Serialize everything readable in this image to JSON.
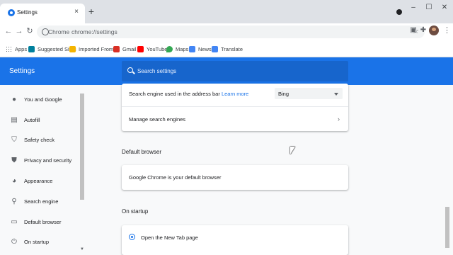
{
  "browser": {
    "tab_title": "Settings",
    "tab_close": "×",
    "new_tab": "+",
    "window_controls": {
      "minimize": "–",
      "maximize": "☐",
      "close": "✕"
    }
  },
  "toolbar": {
    "back": "←",
    "forward": "→",
    "reload": "↻",
    "site_label": "Chrome",
    "url": "chrome://settings",
    "star": "☆",
    "menu": "⋮"
  },
  "bookmarks": [
    {
      "label": "Apps",
      "icon": "apps-grid-icon",
      "color": "#5f6368"
    },
    {
      "label": "Suggested Sites",
      "icon": "bing-icon",
      "color": "#00809d"
    },
    {
      "label": "Imported From IE",
      "icon": "folder-icon",
      "color": "#f4b400"
    },
    {
      "label": "Gmail",
      "icon": "gmail-icon",
      "color": "#d93025"
    },
    {
      "label": "YouTube",
      "icon": "youtube-icon",
      "color": "#ff0000"
    },
    {
      "label": "Maps",
      "icon": "maps-pin-icon",
      "color": "#34a853"
    },
    {
      "label": "News",
      "icon": "news-icon",
      "color": "#4285f4"
    },
    {
      "label": "Translate",
      "icon": "translate-icon",
      "color": "#4285f4"
    }
  ],
  "header": {
    "title": "Settings",
    "search_placeholder": "Search settings",
    "accent": "#1a73e8"
  },
  "sidebar": {
    "items": [
      {
        "label": "You and Google",
        "icon": "person-icon"
      },
      {
        "label": "Autofill",
        "icon": "clipboard-icon"
      },
      {
        "label": "Safety check",
        "icon": "shield-check-icon"
      },
      {
        "label": "Privacy and security",
        "icon": "shield-icon"
      },
      {
        "label": "Appearance",
        "icon": "palette-icon"
      },
      {
        "label": "Search engine",
        "icon": "search-icon"
      },
      {
        "label": "Default browser",
        "icon": "browser-window-icon"
      },
      {
        "label": "On startup",
        "icon": "power-icon"
      }
    ]
  },
  "search_engine": {
    "row_text": "Search engine used in the address bar",
    "learn_more": "Learn more",
    "selected": "Bing",
    "manage": "Manage search engines"
  },
  "default_browser": {
    "title": "Default browser",
    "status": "Google Chrome is your default browser"
  },
  "on_startup": {
    "title": "On startup",
    "option": "Open the New Tab page"
  }
}
